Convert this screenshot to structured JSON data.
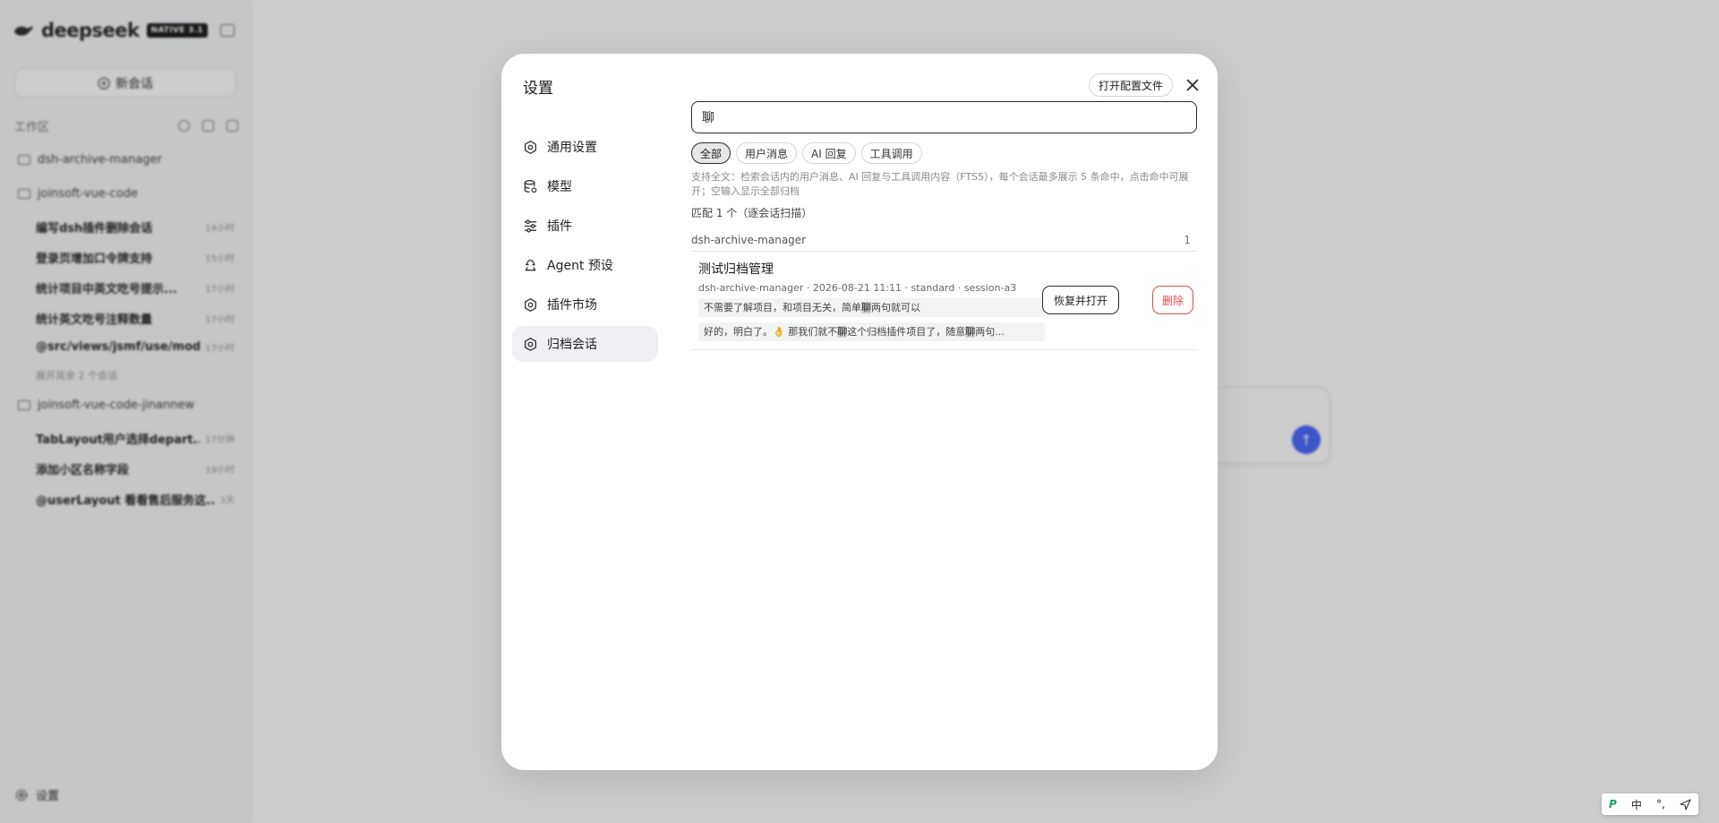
{
  "sidebar": {
    "brand": "deepseek",
    "badge": "NATIVE 3.1",
    "new_chat": "新会话",
    "workspace_label": "工作区",
    "folders": [
      {
        "name": "dsh-archive-manager"
      },
      {
        "name": "joinsoft-vue-code"
      },
      {
        "name": "joinsoft-vue-code-jinannew"
      }
    ],
    "items_group1": [
      {
        "label": "编写dsh插件删除会话",
        "time": "14小时"
      },
      {
        "label": "登录页增加口令牌支持",
        "time": "15小时"
      },
      {
        "label": "统计项目中英文吃号提示...",
        "time": "17小时"
      },
      {
        "label": "统计英文吃号注释数量",
        "time": "17小时"
      },
      {
        "label": "@src/views/jsmf/use/mod...",
        "time": "17小时"
      }
    ],
    "more_label": "展开其余 2 个会话",
    "items_group2": [
      {
        "label": "TabLayout用户选择depart...",
        "time": "17分钟"
      },
      {
        "label": "添加小区名称字段",
        "time": "19小时"
      },
      {
        "label": "@userLayout 看看售后服务这...",
        "time": "3天"
      }
    ],
    "settings": "设置"
  },
  "modal": {
    "title": "设置",
    "open_config": "打开配置文件",
    "nav": [
      {
        "label": "通用设置",
        "icon": "gear-icon"
      },
      {
        "label": "模型",
        "icon": "database-icon"
      },
      {
        "label": "插件",
        "icon": "sliders-icon"
      },
      {
        "label": "Agent 预设",
        "icon": "recycle-icon"
      },
      {
        "label": "插件市场",
        "icon": "gear-icon"
      },
      {
        "label": "归档会话",
        "icon": "gear-icon"
      }
    ],
    "active_nav": "归档会话",
    "search_value": "聊",
    "filters": [
      "全部",
      "用户消息",
      "AI 回复",
      "工具调用"
    ],
    "active_filter": "全部",
    "hint": "支持全文：检索会话内的用户消息、AI 回复与工具调用内容（FTS5），每个会话最多展示 5 条命中，点击命中可展开；空输入显示全部归档",
    "match_count": "匹配 1 个（逐会话扫描）",
    "group": {
      "name": "dsh-archive-manager",
      "count": "1"
    },
    "result": {
      "title": "测试归档管理",
      "meta": "dsh-archive-manager · 2026-08-21 11:11 · standard · session-a3",
      "snippet1": {
        "before": "不需要了解项目，和项目无关，简单",
        "hl": "聊",
        "after": "两句就可以"
      },
      "snippet2": {
        "before": "好的，明白了。👌 那我们就不",
        "hl": "聊",
        "mid": "这个归档插件项目了，随意",
        "hl2": "聊",
        "after": "两句..."
      },
      "restore": "恢复并打开",
      "delete": "删除"
    }
  },
  "ime": {
    "lang": "中",
    "punct": "°,"
  },
  "colors": {
    "danger": "#e24a4a",
    "accent": "#4d6bfe"
  }
}
